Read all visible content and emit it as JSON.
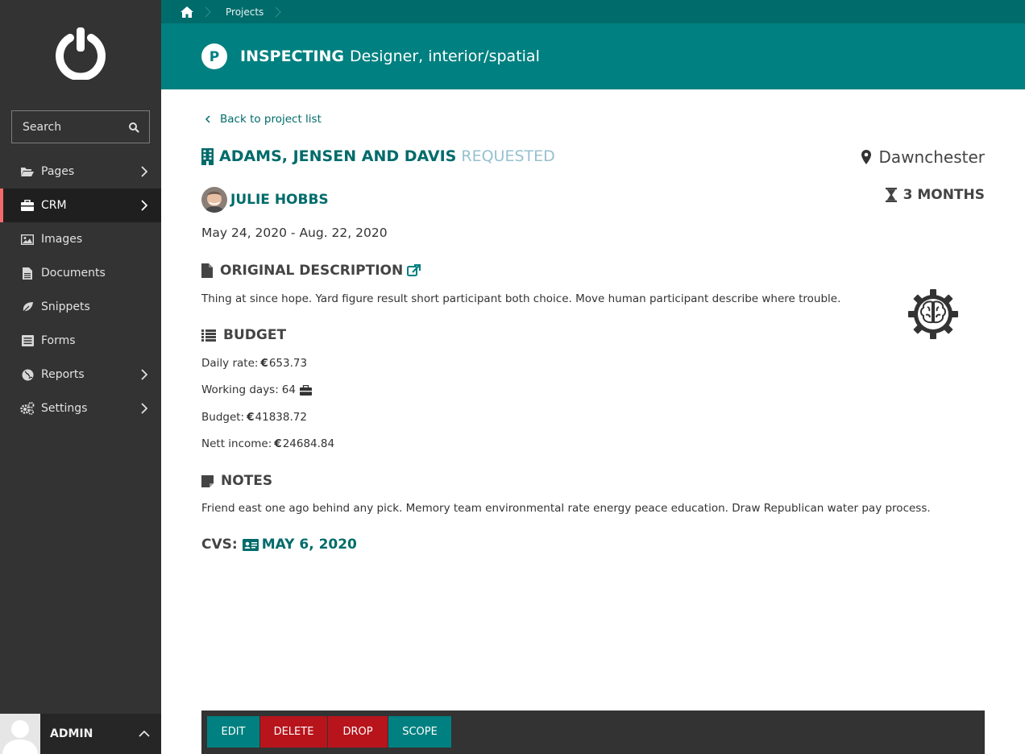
{
  "sidebar": {
    "search_placeholder": "Search",
    "items": [
      {
        "label": "Pages",
        "icon": "folder-open-icon",
        "has_submenu": true
      },
      {
        "label": "CRM",
        "icon": "briefcase-icon",
        "has_submenu": true,
        "active": true
      },
      {
        "label": "Images",
        "icon": "image-icon",
        "has_submenu": false
      },
      {
        "label": "Documents",
        "icon": "document-icon",
        "has_submenu": false
      },
      {
        "label": "Snippets",
        "icon": "leaf-icon",
        "has_submenu": false
      },
      {
        "label": "Forms",
        "icon": "form-icon",
        "has_submenu": false
      },
      {
        "label": "Reports",
        "icon": "globe-icon",
        "has_submenu": true
      },
      {
        "label": "Settings",
        "icon": "cogs-icon",
        "has_submenu": true
      }
    ],
    "user_label": "ADMIN"
  },
  "breadcrumb": {
    "home_icon": "home-icon",
    "items": [
      "Projects"
    ]
  },
  "header": {
    "badge_letter": "P",
    "action": "INSPECTING",
    "subject": "Designer, interior/spatial"
  },
  "project": {
    "back_link": "Back to project list",
    "company": "ADAMS, JENSEN AND DAVIS",
    "status": "REQUESTED",
    "location": "Dawnchester",
    "person": "JULIE HOBBS",
    "duration": "3 MONTHS",
    "dates": "May 24, 2020 - Aug. 22, 2020",
    "description_heading": "ORIGINAL DESCRIPTION",
    "description": "Thing at since hope. Yard figure result short participant both choice. Move human participant describe where trouble.",
    "budget_heading": "BUDGET",
    "daily_rate_label": "Daily rate:",
    "daily_rate": "653.73",
    "working_days_label": "Working days:",
    "working_days": "64",
    "budget_label": "Budget:",
    "budget": "41838.72",
    "nett_income_label": "Nett income:",
    "nett_income": "24684.84",
    "currency_symbol": "€",
    "notes_heading": "NOTES",
    "notes": "Friend east one ago behind any pick. Memory team environmental rate energy peace education. Draw Republican water pay process.",
    "cvs_label": "CVS:",
    "cvs_date": "MAY 6, 2020"
  },
  "actions": {
    "edit": "EDIT",
    "delete": "DELETE",
    "drop": "DROP",
    "scope": "SCOPE"
  },
  "colors": {
    "teal": "#008080",
    "teal_dark": "#006b6b",
    "sidebar": "#333333",
    "danger": "#b8141c",
    "status_requested": "#97c0cf",
    "active_marker": "#f46a6a"
  }
}
